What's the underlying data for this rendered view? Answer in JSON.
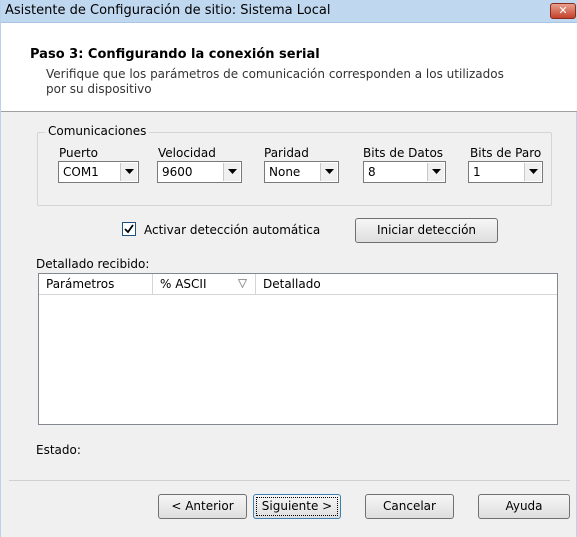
{
  "window": {
    "title": "Asistente de Configuración de sitio: Sistema Local",
    "close_label": "✕"
  },
  "header": {
    "step_title": "Paso 3: Configurando la conexión serial",
    "step_description": "Verifique que los parámetros de comunicación corresponden a los utilizados por su dispositivo"
  },
  "communications": {
    "legend": "Comunicaciones",
    "port": {
      "label": "Puerto",
      "value": "COM1"
    },
    "speed": {
      "label": "Velocidad",
      "value": "9600"
    },
    "parity": {
      "label": "Paridad",
      "value": "None"
    },
    "data_bits": {
      "label": "Bits de Datos",
      "value": "8"
    },
    "stop_bits": {
      "label": "Bits de Paro",
      "value": "1"
    }
  },
  "auto_detect": {
    "checkbox_label": "Activar detección automática",
    "checked": true,
    "start_button": "Iniciar detección"
  },
  "received": {
    "label": "Detallado recibido:",
    "columns": [
      "Parámetros",
      "% ASCII",
      "Detallado"
    ]
  },
  "status": {
    "label": "Estado:"
  },
  "footer": {
    "back": "< Anterior",
    "next": "Siguiente >",
    "cancel": "Cancelar",
    "help": "Ayuda"
  }
}
